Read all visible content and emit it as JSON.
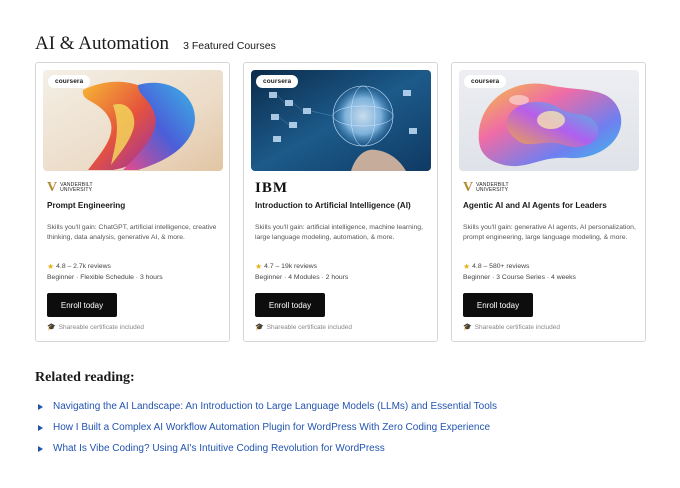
{
  "header": {
    "section_title": "AI & Automation",
    "featured_count": "3 Featured Courses"
  },
  "courses": [
    {
      "provider_badge": "coursera",
      "institution_logo": "vanderbilt-logo",
      "institution_line1": "VANDERBILT",
      "institution_line2": "UNIVERSITY",
      "title": "Prompt Engineering",
      "skills": "Skills you'll gain: ChatGPT, artificial intelligence, creative thinking, data analysis, generative AI, & more.",
      "rating": "4.8 – 2.7k reviews",
      "meta": "Beginner · Flexible Schedule · 3 hours",
      "enroll_label": "Enroll today",
      "certificate": "Shareable certificate included"
    },
    {
      "provider_badge": "coursera",
      "institution_logo": "ibm-logo",
      "institution_name": "IBM",
      "title": "Introduction to Artificial Intelligence (AI)",
      "skills": "Skills you'll gain: artificial intelligence, machine learning, large language modeling, automation, & more.",
      "rating": "4.7 – 19k reviews",
      "meta": "Beginner · 4 Modules · 2 hours",
      "enroll_label": "Enroll today",
      "certificate": "Shareable certificate included"
    },
    {
      "provider_badge": "coursera",
      "institution_logo": "vanderbilt-logo",
      "institution_line1": "VANDERBILT",
      "institution_line2": "UNIVERSITY",
      "title": "Agentic AI and AI Agents for Leaders",
      "skills": "Skills you'll gain: generative AI agents, AI personalization, prompt engineering, large language modeling, & more.",
      "rating": "4.8 – 580+ reviews",
      "meta": "Beginner · 3 Course Series · 4 weeks",
      "enroll_label": "Enroll today",
      "certificate": "Shareable certificate included"
    }
  ],
  "related": {
    "title": "Related reading:",
    "links": [
      "Navigating the AI Landscape: An Introduction to Large Language Models (LLMs) and Essential Tools",
      "How I Built a Complex AI Workflow Automation Plugin for WordPress With Zero Coding Experience",
      "What Is Vibe Coding? Using AI's Intuitive Coding Revolution for WordPress"
    ]
  },
  "colors": {
    "link": "#2354b0",
    "button_bg": "#0d0d0d",
    "star": "#e3b41c",
    "vanderbilt_gold": "#b38b2f"
  }
}
